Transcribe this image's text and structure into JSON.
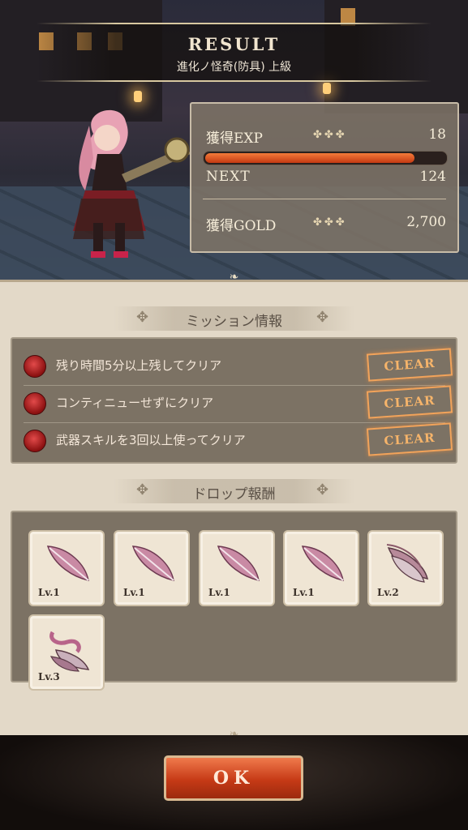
{
  "header": {
    "title": "RESULT",
    "subtitle": "進化ノ怪奇(防具) 上級"
  },
  "stats": {
    "exp_label": "獲得EXP",
    "exp_value": "18",
    "exp_progress": 0.87,
    "next_label": "NEXT",
    "next_value": "124",
    "gold_label": "獲得GOLD",
    "gold_value": "2,700",
    "ornament": "✤✤✤"
  },
  "missions": {
    "heading": "ミッション情報",
    "items": [
      {
        "text": "残り時間5分以上残してクリア",
        "status": "CLEAR"
      },
      {
        "text": "コンティニューせずにクリア",
        "status": "CLEAR"
      },
      {
        "text": "武器スキルを3回以上使ってクリア",
        "status": "CLEAR"
      }
    ]
  },
  "drops": {
    "heading": "ドロップ報酬",
    "items": [
      {
        "level": "Lv.1",
        "icon": "pink-feather-icon"
      },
      {
        "level": "Lv.1",
        "icon": "pink-feather-icon"
      },
      {
        "level": "Lv.1",
        "icon": "pink-feather-icon"
      },
      {
        "level": "Lv.1",
        "icon": "pink-feather-icon"
      },
      {
        "level": "Lv.2",
        "icon": "wing-cluster-icon"
      },
      {
        "level": "Lv.3",
        "icon": "winged-ornament-icon"
      }
    ]
  },
  "ok_button": "OK",
  "colors": {
    "accent": "#c63a16",
    "clear_stamp": "#f2a35a",
    "exp_bar": "#e2541e"
  }
}
